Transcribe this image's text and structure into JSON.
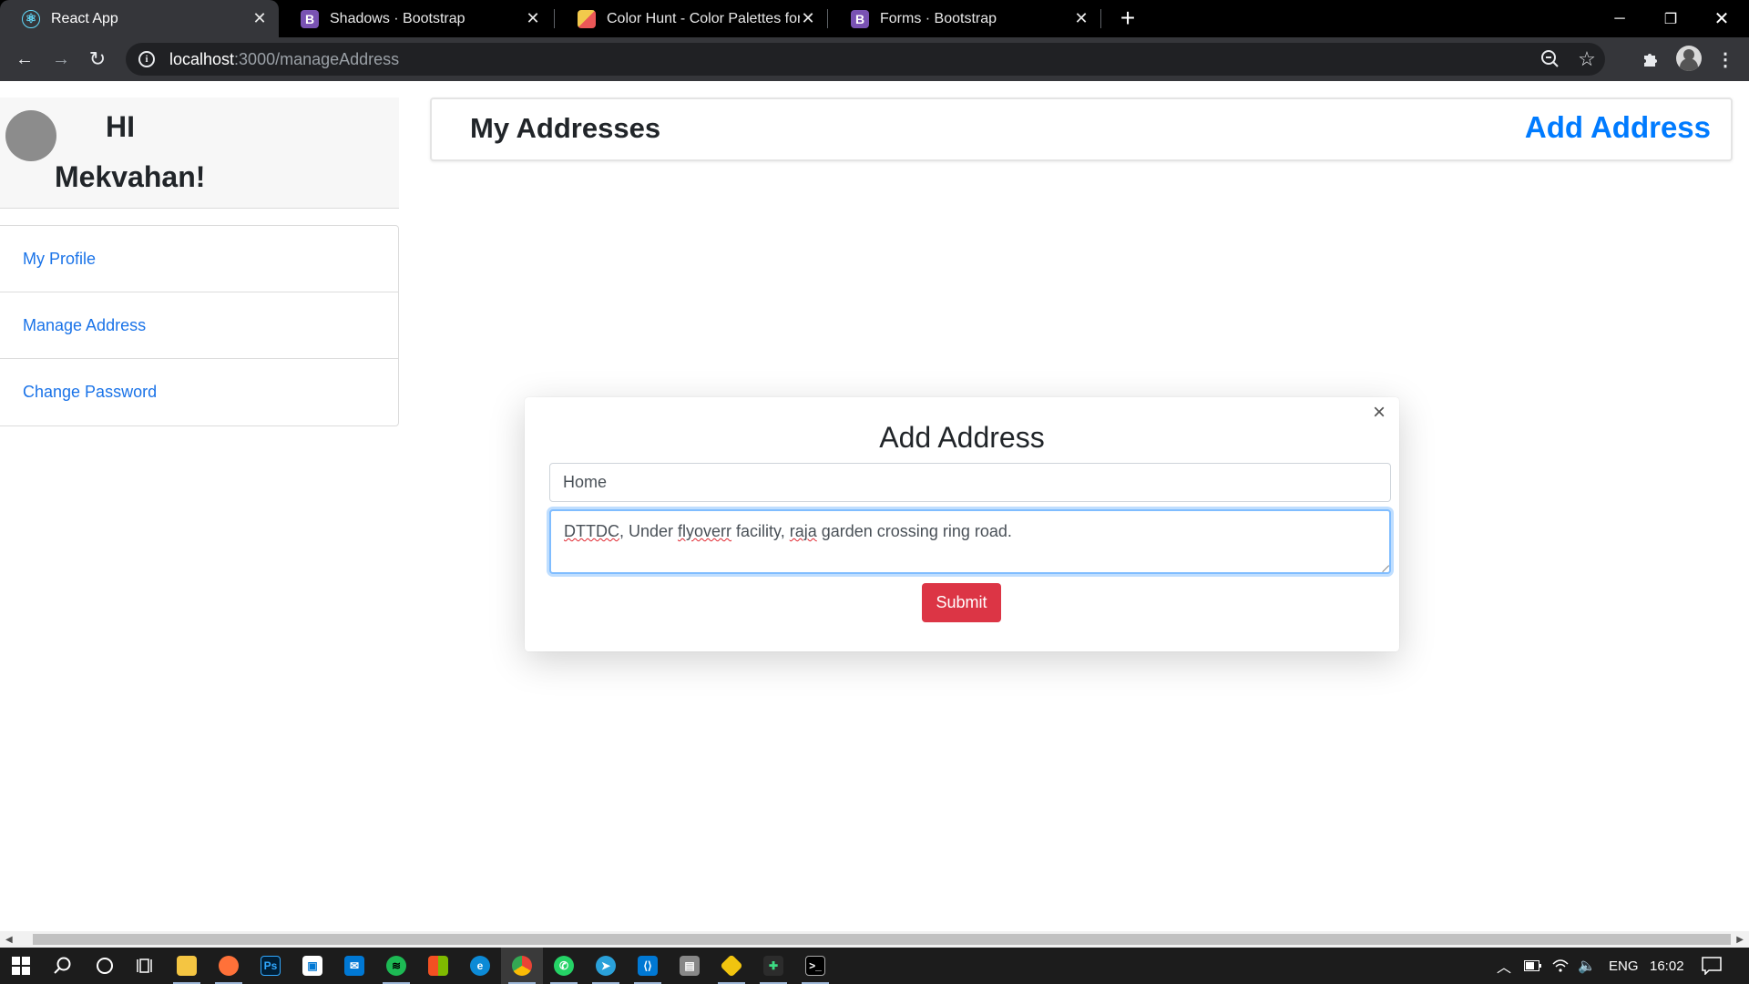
{
  "browser": {
    "tabs": [
      {
        "title": "React App",
        "icon": "react-icon",
        "icon_color": "#61dafb",
        "active": true
      },
      {
        "title": "Shadows · Bootstrap",
        "icon": "bootstrap-icon",
        "icon_color": "#7952b3"
      },
      {
        "title": "Color Hunt - Color Palettes for Desig",
        "icon": "colorhunt-icon",
        "icon_color": "#f2c94c"
      },
      {
        "title": "Forms · Bootstrap",
        "icon": "bootstrap-icon",
        "icon_color": "#7952b3"
      }
    ],
    "url_host": "localhost",
    "url_path": ":3000/manageAddress"
  },
  "sidebar": {
    "greeting_line1": "HI",
    "greeting_line2": "Mekvahan!",
    "items": [
      {
        "label": "My Profile"
      },
      {
        "label": "Manage Address"
      },
      {
        "label": "Change Password"
      }
    ]
  },
  "main": {
    "title": "My Addresses",
    "add_link": "Add Address"
  },
  "modal": {
    "title": "Add Address",
    "close_symbol": "×",
    "name_value": "Home",
    "address_parts": [
      "DTTDC",
      ", Under ",
      "flyoverr",
      " facility, ",
      "raja",
      " garden crossing ring road."
    ],
    "submit_label": "Submit"
  },
  "taskbar": {
    "language": "ENG",
    "time": "16:02"
  },
  "colors": {
    "link": "#007bff",
    "danger": "#dc3545",
    "focus": "#80bdff"
  }
}
